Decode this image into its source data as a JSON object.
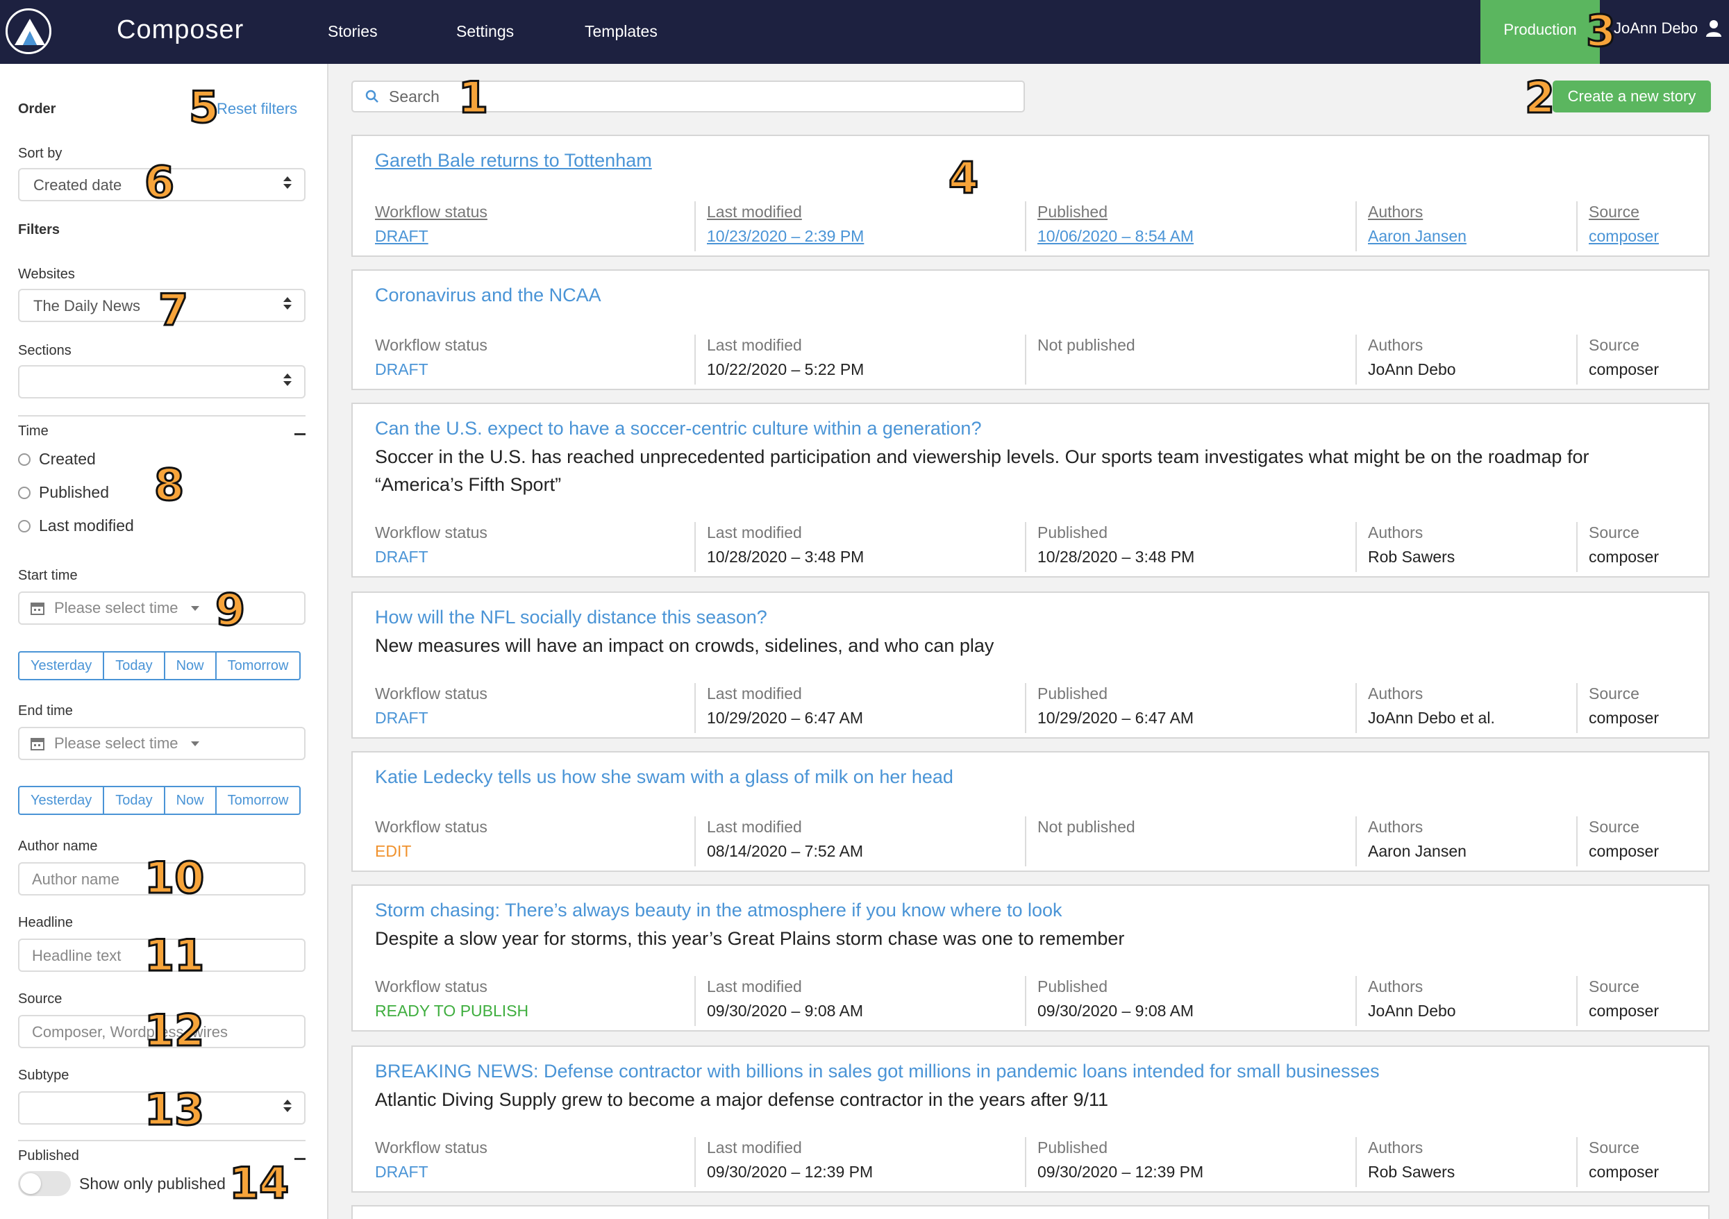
{
  "header": {
    "app_title": "Composer",
    "nav": [
      "Stories",
      "Settings",
      "Templates"
    ],
    "environment": "Production",
    "user_name": "JoAnn Debo"
  },
  "sidebar": {
    "order_label": "Order",
    "reset_filters": "Reset filters",
    "sort_by_label": "Sort by",
    "sort_by_value": "Created date",
    "filters_label": "Filters",
    "websites_label": "Websites",
    "websites_value": "The Daily News",
    "sections_label": "Sections",
    "sections_value": "",
    "time_label": "Time",
    "time_options": [
      "Created",
      "Published",
      "Last modified"
    ],
    "start_time_label": "Start time",
    "start_time_placeholder": "Please select time",
    "end_time_label": "End time",
    "end_time_placeholder": "Please select time",
    "quick_times": [
      "Yesterday",
      "Today",
      "Now",
      "Tomorrow"
    ],
    "author_label": "Author name",
    "author_placeholder": "Author name",
    "headline_label": "Headline",
    "headline_placeholder": "Headline text",
    "source_label": "Source",
    "source_placeholder": "Composer, Wordpress, wires",
    "subtype_label": "Subtype",
    "subtype_value": "",
    "published_label": "Published",
    "show_only_published": "Show only published"
  },
  "main": {
    "search_placeholder": "Search",
    "create_button": "Create a new story",
    "meta_labels": {
      "workflow": "Workflow status",
      "modified": "Last modified",
      "published": "Published",
      "not_published": "Not published",
      "authors": "Authors",
      "source": "Source"
    },
    "stories": [
      {
        "title": "Gareth Bale returns to Tottenham",
        "desc": "",
        "status": "DRAFT",
        "modified": "10/23/2020 – 2:39 PM",
        "published": "10/06/2020 – 8:54 AM",
        "authors": "Aaron Jansen",
        "source": "composer"
      },
      {
        "title": "Coronavirus and the NCAA",
        "desc": "",
        "status": "DRAFT",
        "modified": "10/22/2020 – 5:22 PM",
        "published": "",
        "authors": "JoAnn Debo",
        "source": "composer"
      },
      {
        "title": "Can the U.S. expect to have a soccer-centric culture within a generation?",
        "desc": "Soccer in the U.S. has reached unprecedented participation and viewership levels. Our sports team investigates what might be on the roadmap for “America’s Fifth Sport”",
        "status": "DRAFT",
        "modified": "10/28/2020 – 3:48 PM",
        "published": "10/28/2020 – 3:48 PM",
        "authors": "Rob Sawers",
        "source": "composer"
      },
      {
        "title": "How will the NFL socially distance this season?",
        "desc": "New measures will have an impact on crowds, sidelines, and who can play",
        "status": "DRAFT",
        "modified": "10/29/2020 – 6:47 AM",
        "published": "10/29/2020 – 6:47 AM",
        "authors": "JoAnn Debo et al.",
        "source": "composer"
      },
      {
        "title": "Katie Ledecky tells us how she swam with a glass of milk on her head",
        "desc": "",
        "status": "EDIT",
        "modified": "08/14/2020 – 7:52 AM",
        "published": "",
        "authors": "Aaron Jansen",
        "source": "composer"
      },
      {
        "title": "Storm chasing: There’s always beauty in the atmosphere if you know where to look",
        "desc": "Despite a slow year for storms, this year’s Great Plains storm chase was one to remember",
        "status": "READY TO PUBLISH",
        "modified": "09/30/2020 – 9:08 AM",
        "published": "09/30/2020 – 9:08 AM",
        "authors": "JoAnn Debo",
        "source": "composer"
      },
      {
        "title": "BREAKING NEWS: Defense contractor with billions in sales got millions in pandemic loans intended for small businesses",
        "desc": "Atlantic Diving Supply grew to become a major defense contractor in the years after 9/11",
        "status": "DRAFT",
        "modified": "09/30/2020 – 12:39 PM",
        "published": "09/30/2020 – 12:39 PM",
        "authors": "Rob Sawers",
        "source": "composer"
      }
    ]
  },
  "callouts": [
    "1",
    "2",
    "3",
    "4",
    "5",
    "6",
    "7",
    "8",
    "9",
    "10",
    "11",
    "12",
    "13",
    "14"
  ],
  "colors": {
    "navbar": "#1d2140",
    "accent_green": "#5bb65f",
    "link_blue": "#4a94d6",
    "edit_orange": "#f0922e",
    "ready_green": "#3fae3f"
  }
}
